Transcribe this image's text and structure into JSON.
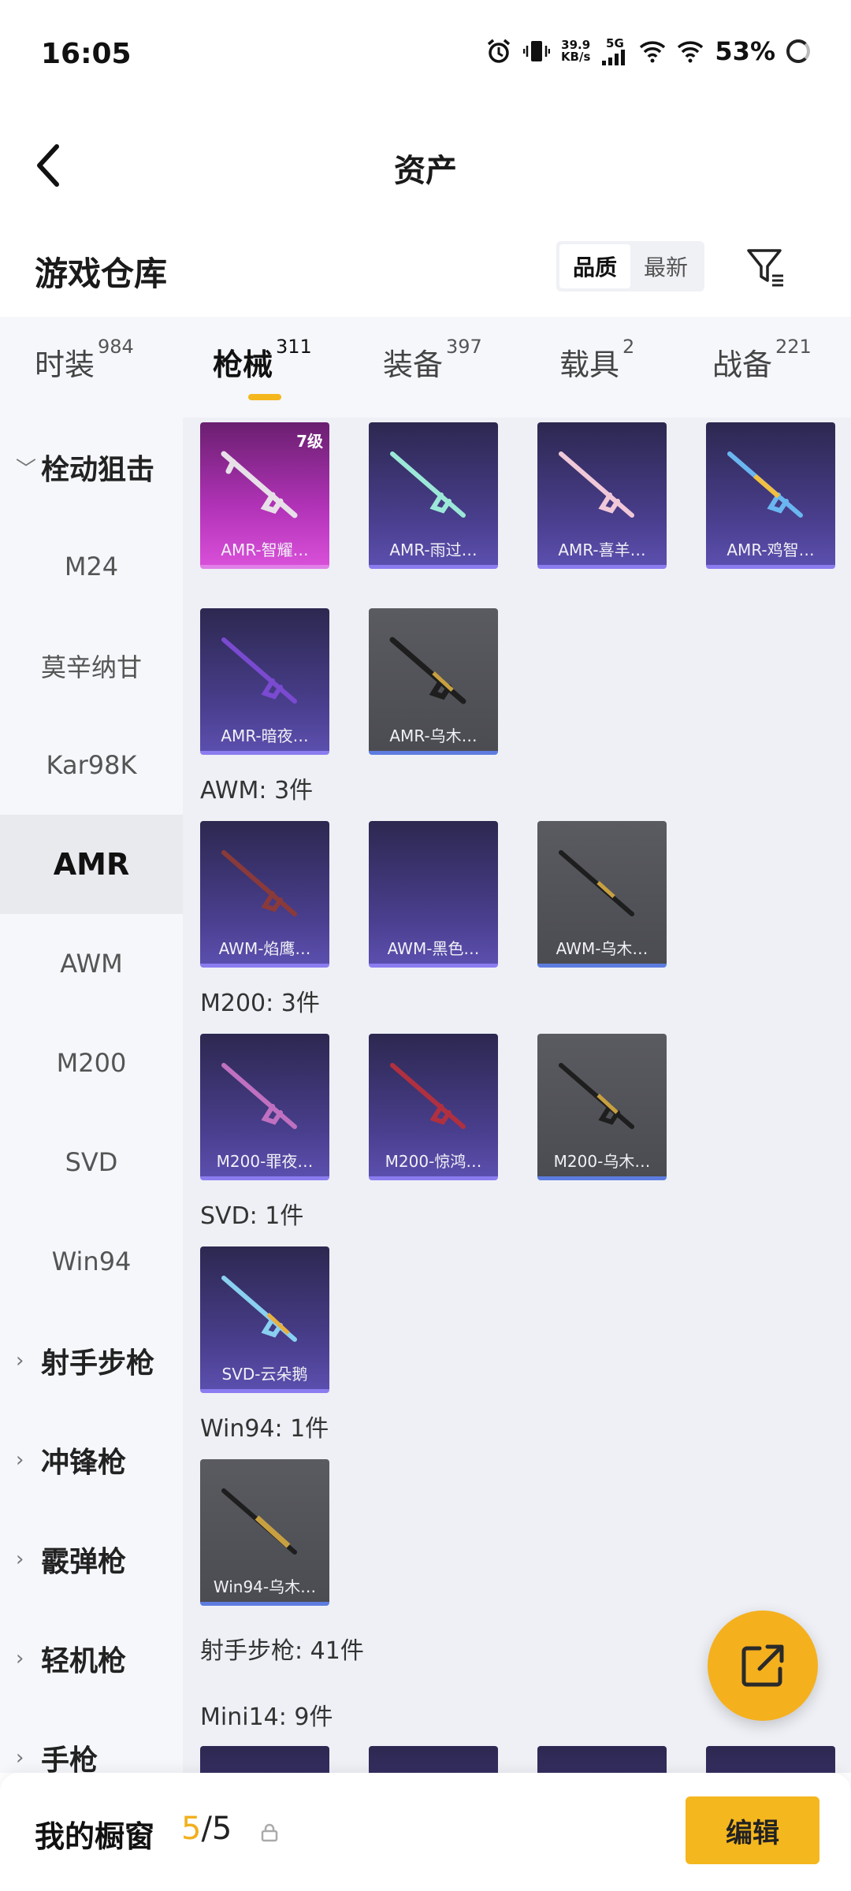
{
  "status_bar": {
    "time": "16:05",
    "net_speed_top": "39.9",
    "net_speed_bottom": "KB/s",
    "network": "5G",
    "battery": "53%"
  },
  "header": {
    "title": "资产"
  },
  "warehouse": {
    "title": "游戏仓库",
    "sort_options": [
      "品质",
      "最新"
    ],
    "sort_selected": "品质"
  },
  "tabs": [
    {
      "label": "时装",
      "count": "984"
    },
    {
      "label": "枪械",
      "count": "311",
      "active": true
    },
    {
      "label": "装备",
      "count": "397"
    },
    {
      "label": "载具",
      "count": "2"
    },
    {
      "label": "战备",
      "count": "221"
    }
  ],
  "sidebar": {
    "items": [
      {
        "label": "栓动狙击",
        "type": "group-expanded"
      },
      {
        "label": "M24"
      },
      {
        "label": "莫辛纳甘"
      },
      {
        "label": "Kar98K"
      },
      {
        "label": "AMR",
        "active": true
      },
      {
        "label": "AWM"
      },
      {
        "label": "M200"
      },
      {
        "label": "SVD"
      },
      {
        "label": "Win94"
      },
      {
        "label": "射手步枪",
        "type": "group"
      },
      {
        "label": "冲锋枪",
        "type": "group"
      },
      {
        "label": "霰弹枪",
        "type": "group"
      },
      {
        "label": "轻机枪",
        "type": "group"
      },
      {
        "label": "手枪",
        "type": "group"
      }
    ]
  },
  "sections": {
    "awm": "AWM: 3件",
    "m200": "M200: 3件",
    "svd": "SVD: 1件",
    "win94": "Win94: 1件",
    "marksman": "射手步枪: 41件",
    "mini14": "Mini14: 9件"
  },
  "cards": {
    "amr": [
      {
        "name": "AMR-智耀…",
        "level": "7级",
        "tier": "pink"
      },
      {
        "name": "AMR-雨过…",
        "tier": "purple"
      },
      {
        "name": "AMR-喜羊…",
        "tier": "purple"
      },
      {
        "name": "AMR-鸡智…",
        "tier": "purple"
      },
      {
        "name": "AMR-暗夜…",
        "tier": "purple"
      },
      {
        "name": "AMR-乌木…",
        "tier": "gray"
      }
    ],
    "awm": [
      {
        "name": "AWM-焰鹰…",
        "tier": "purple"
      },
      {
        "name": "AWM-黑色…",
        "tier": "purple"
      },
      {
        "name": "AWM-乌木…",
        "tier": "gray"
      }
    ],
    "m200": [
      {
        "name": "M200-罪夜…",
        "tier": "purple"
      },
      {
        "name": "M200-惊鸿…",
        "tier": "purple"
      },
      {
        "name": "M200-乌木…",
        "tier": "gray"
      }
    ],
    "svd": [
      {
        "name": "SVD-云朵鹅",
        "tier": "purple"
      }
    ],
    "win94": [
      {
        "name": "Win94-乌木…",
        "tier": "gray"
      }
    ]
  },
  "bottom_bar": {
    "label": "我的橱窗",
    "count_current": "5",
    "count_total": "/5",
    "edit_label": "编辑"
  },
  "colors": {
    "accent": "#f5b71e",
    "purple_card": "#4a3f8f",
    "gray_card": "#4b4c52",
    "pink_card": "#b233b8"
  }
}
